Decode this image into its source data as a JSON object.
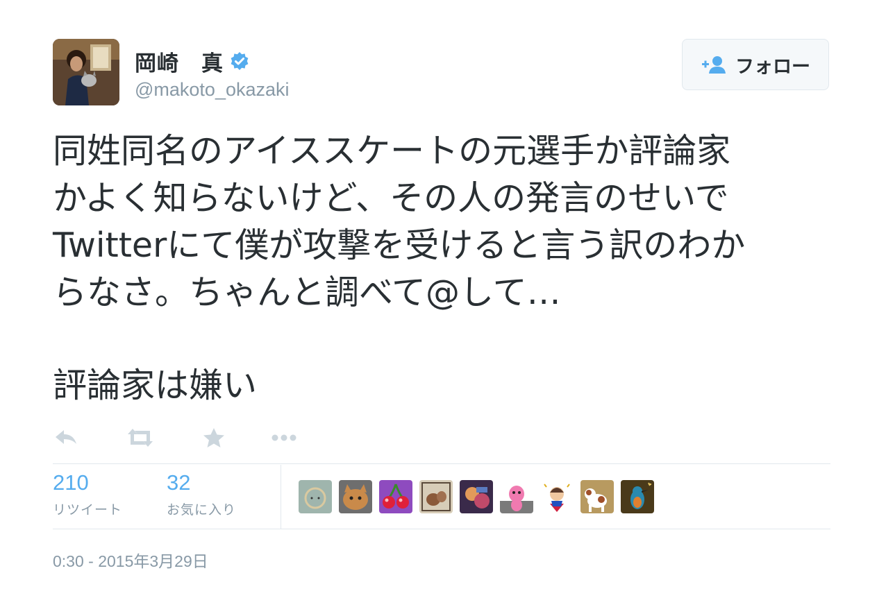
{
  "tweet": {
    "user": {
      "display_name": "岡崎　真",
      "screen_name": "@makoto_okazaki",
      "verified": true,
      "avatar_icon": "user-avatar"
    },
    "follow_button": {
      "label": "フォロー",
      "icon": "add-user-icon"
    },
    "text_lines": "同姓同名のアイススケートの元選手か評論家\nかよく知らないけど、その人の発言のせいで\nTwitterにて僕が攻撃を受けると言う訳のわか\nらなさ。ちゃんと調べて@して…",
    "text_last": "評論家は嫌い",
    "actions": [
      {
        "name": "reply-icon"
      },
      {
        "name": "retweet-icon"
      },
      {
        "name": "favorite-icon"
      },
      {
        "name": "more-icon"
      }
    ],
    "stats": {
      "retweets": {
        "count": "210",
        "label": "リツイート"
      },
      "favorites": {
        "count": "32",
        "label": "お気に入り"
      }
    },
    "timestamp": "0:30 - 2015年3月29日"
  },
  "colors": {
    "text": "#292f33",
    "secondary": "#8899a6",
    "accent": "#55acee",
    "border": "#e1e8ed",
    "action_icon": "#ccd6dd"
  }
}
